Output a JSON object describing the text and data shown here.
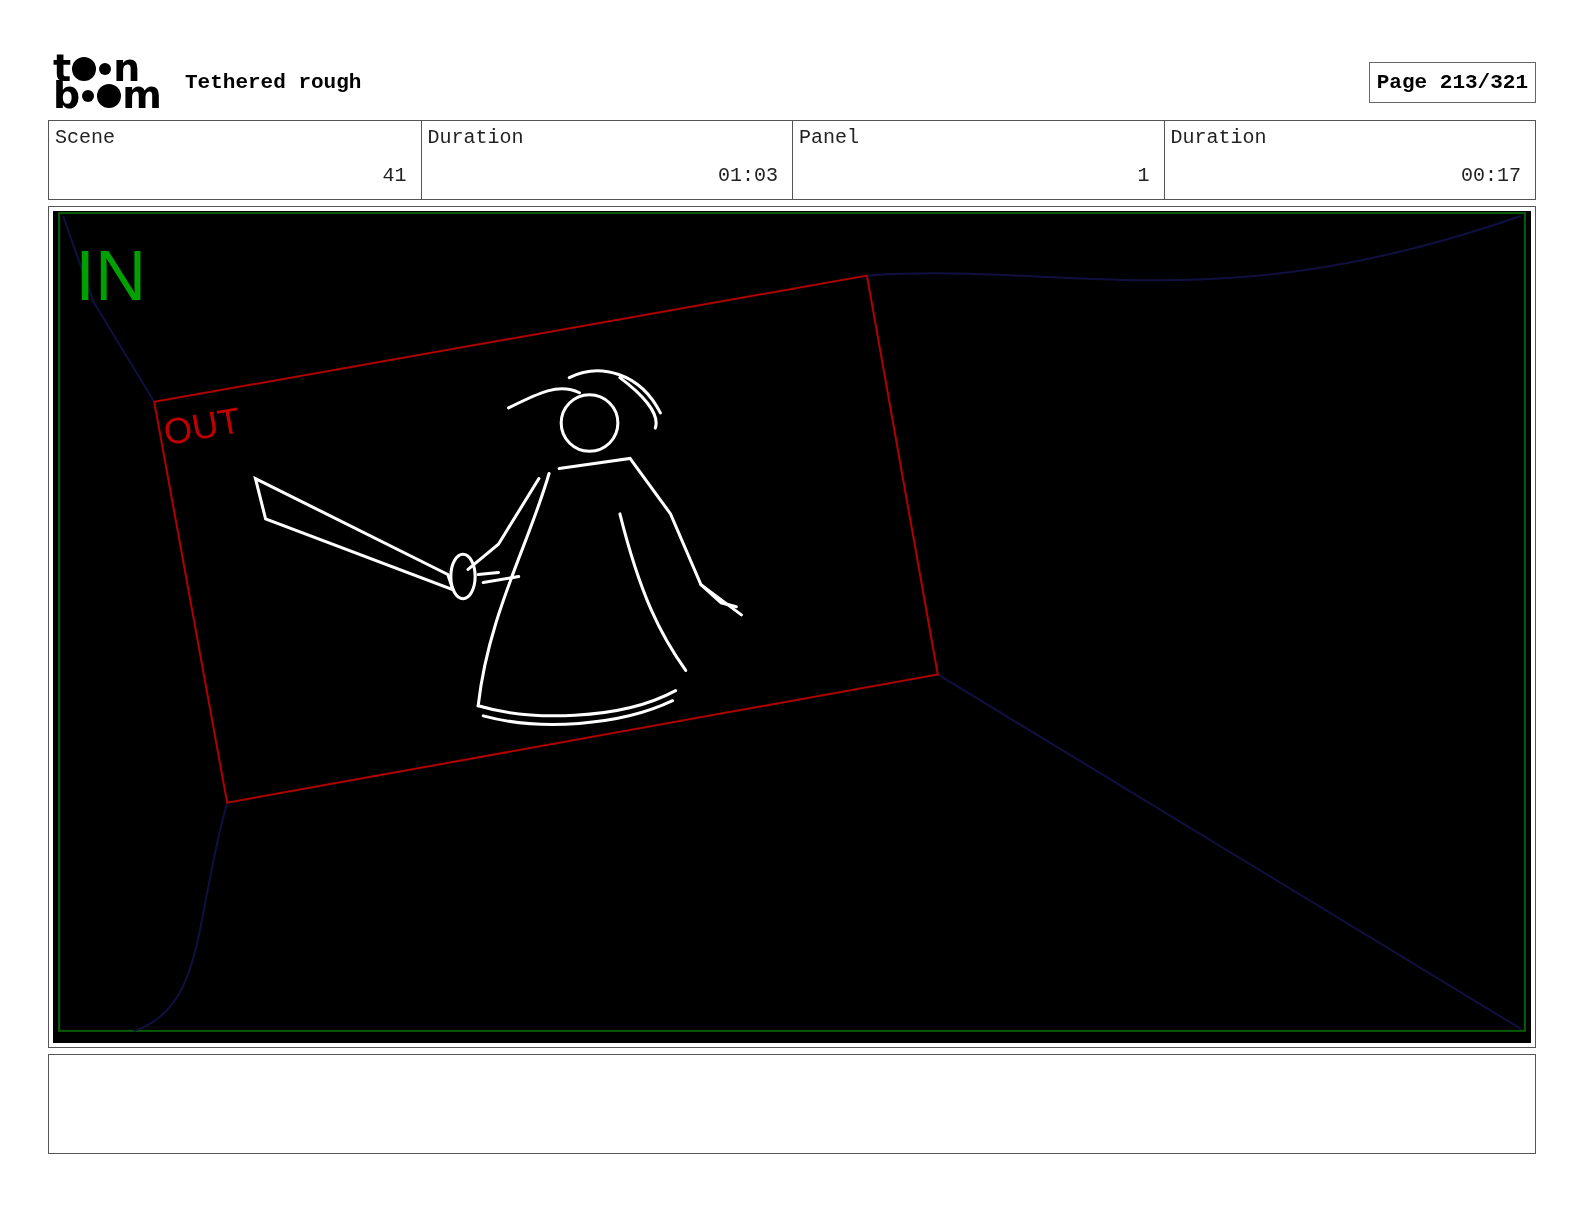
{
  "logo": {
    "top": [
      "t",
      "n"
    ],
    "bottom": [
      "b",
      "m"
    ]
  },
  "title": "Tethered rough",
  "page": "Page 213/321",
  "fields": [
    {
      "label": "Scene",
      "value": "41"
    },
    {
      "label": "Duration",
      "value": "01:03"
    },
    {
      "label": "Panel",
      "value": "1"
    },
    {
      "label": "Duration",
      "value": "00:17"
    }
  ],
  "panel": {
    "camera_labels": [
      {
        "kind": "in",
        "text": "IN",
        "color": "#00a000"
      },
      {
        "kind": "out",
        "text": "OUT",
        "color": "#c00000"
      }
    ]
  }
}
